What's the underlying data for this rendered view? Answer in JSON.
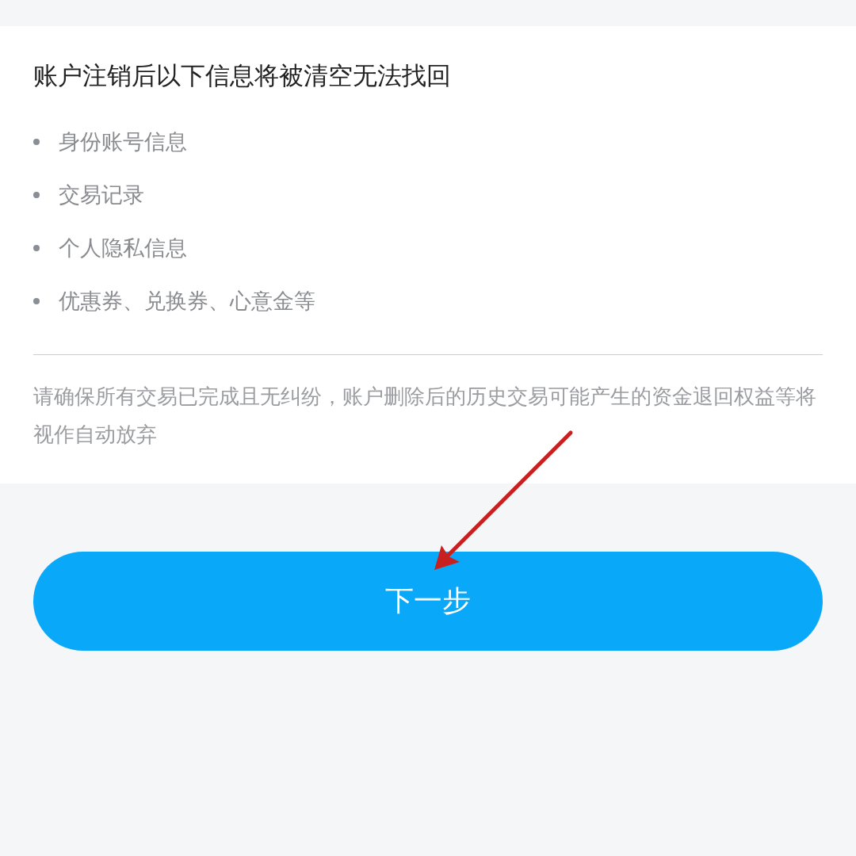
{
  "notice": {
    "title": "账户注销后以下信息将被清空无法找回",
    "items": [
      "身份账号信息",
      "交易记录",
      "个人隐私信息",
      "优惠券、兑换券、心意金等"
    ],
    "note": "请确保所有交易已完成且无纠纷，账户删除后的历史交易可能产生的资金退回权益等将视作自动放弃"
  },
  "next_button": {
    "label": "下一步"
  },
  "annotation": {
    "kind": "arrow"
  }
}
